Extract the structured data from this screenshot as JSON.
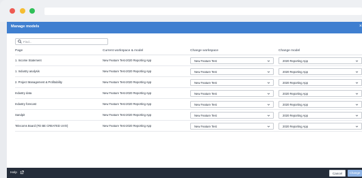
{
  "dialog": {
    "title": "Manage models",
    "close_symbol": "×",
    "search_placeholder": "Find...",
    "columns": {
      "page": "Page",
      "current": "Current workspace & model",
      "change_workspace": "Change workspace",
      "change_model": "Change model"
    },
    "rows": [
      {
        "page": "1. Income Statement",
        "current": "New Feature Test-2020 Reporting App",
        "workspace": "New Feature Test",
        "model": "2020 Reporting App"
      },
      {
        "page": "1. Industry analysis",
        "current": "New Feature Test-2020 Reporting App",
        "workspace": "New Feature Test",
        "model": "2020 Reporting App"
      },
      {
        "page": "2. Project Management & Profitability",
        "current": "New Feature Test-2020 Reporting App",
        "workspace": "New Feature Test",
        "model": "2020 Reporting App"
      },
      {
        "page": "Industry data",
        "current": "New Feature Test-2020 Reporting App",
        "workspace": "New Feature Test",
        "model": "2020 Reporting App"
      },
      {
        "page": "Industry forecast",
        "current": "New Feature Test-2020 Reporting App",
        "workspace": "New Feature Test",
        "model": "2020 Reporting App"
      },
      {
        "page": "Sandpit",
        "current": "New Feature Test-2020 Reporting App",
        "workspace": "New Feature Test",
        "model": "2020 Reporting App"
      },
      {
        "page": "Telecoms Board (FD BE CREATED UVO)",
        "current": "New Feature Test-2020 Reporting App",
        "workspace": "New Feature Test",
        "model": "2020 Reporting App"
      }
    ]
  },
  "footer": {
    "help_label": "Help",
    "cancel_label": "Cancel",
    "change_label": "Change"
  },
  "colors": {
    "titlebar": "#3f7fd0",
    "footer": "#252d3a",
    "change_button": "#8fb4e6"
  },
  "icons": {
    "search": "search-icon",
    "external_link": "external-link-icon",
    "chevron": "chevron-down-icon",
    "close": "close-icon"
  }
}
